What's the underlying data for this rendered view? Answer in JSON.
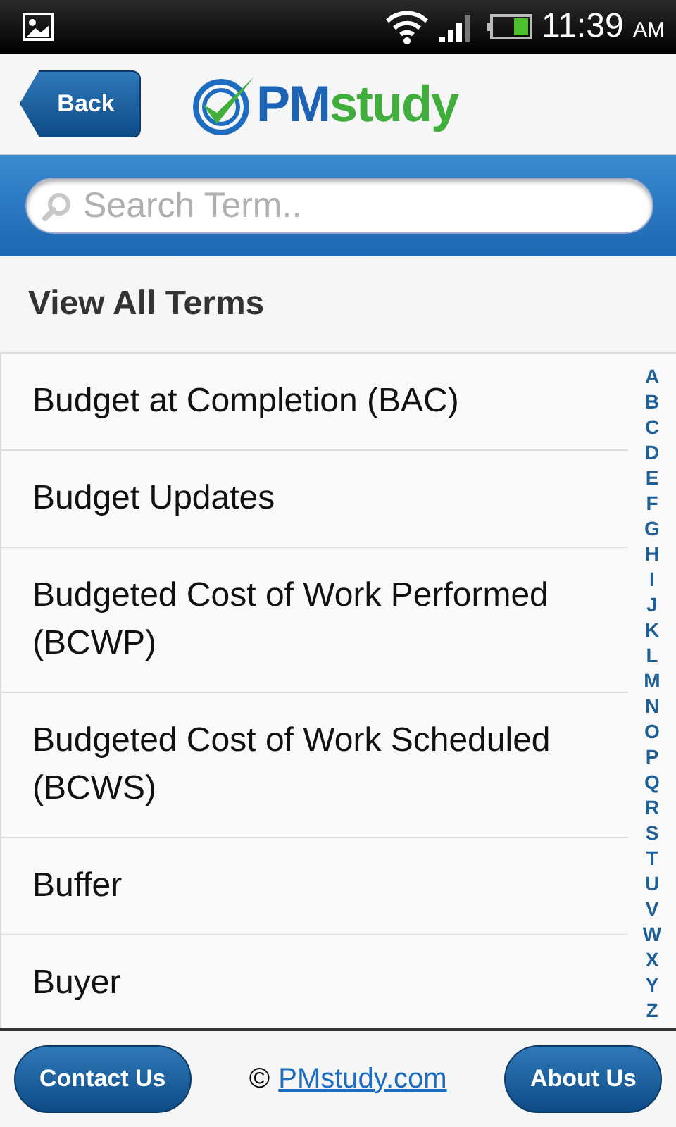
{
  "status_bar": {
    "time": "11:39",
    "period": "AM"
  },
  "header": {
    "back_button": "Back",
    "logo": {
      "part_1": "PM",
      "part_2": "study"
    }
  },
  "search": {
    "placeholder": "Search Term.."
  },
  "section_title": "View All Terms",
  "terms": [
    "Budget at Completion (BAC)",
    "Budget Updates",
    "Budgeted Cost of Work Performed (BCWP)",
    "Budgeted Cost of Work Scheduled (BCWS)",
    "Buffer",
    "Buyer"
  ],
  "index_letters": [
    "A",
    "B",
    "C",
    "D",
    "E",
    "F",
    "G",
    "H",
    "I",
    "J",
    "K",
    "L",
    "M",
    "N",
    "O",
    "P",
    "Q",
    "R",
    "S",
    "T",
    "U",
    "V",
    "W",
    "X",
    "Y",
    "Z"
  ],
  "footer": {
    "left_button": "Contact Us",
    "copyright": "©",
    "link": "PMstudy.com",
    "right_button": "About Us"
  }
}
